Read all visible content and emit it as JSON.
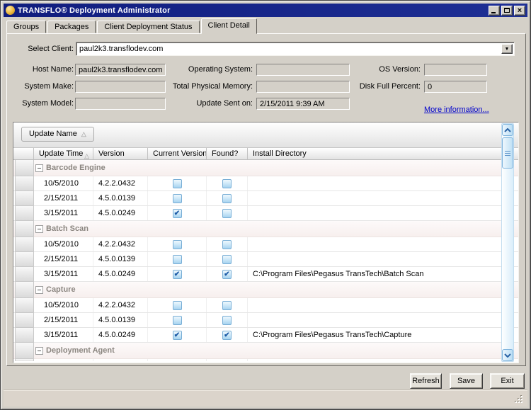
{
  "window": {
    "title": "TRANSFLO® Deployment Administrator",
    "icon": "transflo-gold-sphere-icon",
    "close_glyph": "×"
  },
  "tabs": {
    "items": [
      {
        "label": "Groups"
      },
      {
        "label": "Packages"
      },
      {
        "label": "Client Deployment Status"
      },
      {
        "label": "Client Detail"
      }
    ],
    "active_index": 3
  },
  "form": {
    "select_client": {
      "label": "Select Client:",
      "value": "paul2k3.transflodev.com"
    },
    "host_name": {
      "label": "Host Name:",
      "value": "paul2k3.transflodev.com"
    },
    "operating_system": {
      "label": "Operating System:",
      "value": ""
    },
    "os_version": {
      "label": "OS Version:",
      "value": ""
    },
    "system_make": {
      "label": "System Make:",
      "value": ""
    },
    "total_physical_memory": {
      "label": "Total Physical Memory:",
      "value": ""
    },
    "disk_full_percent": {
      "label": "Disk Full Percent:",
      "value": "0"
    },
    "system_model": {
      "label": "System Model:",
      "value": ""
    },
    "update_sent_on": {
      "label": "Update Sent on:",
      "value": "2/15/2011 9:39 AM"
    },
    "more_information_link": "More information..."
  },
  "grid": {
    "group_by": {
      "button_label": "Update Name",
      "sort_indicator": "△"
    },
    "check_glyph": "✔",
    "columns": [
      {
        "label": ""
      },
      {
        "label": "Update Time",
        "sort": "△"
      },
      {
        "label": "Version"
      },
      {
        "label": "Current Version?"
      },
      {
        "label": "Found?"
      },
      {
        "label": "Install Directory"
      }
    ],
    "groups": [
      {
        "name": "Barcode Engine",
        "rows": [
          {
            "update_time": "10/5/2010",
            "version": "4.2.2.0432",
            "current_version": false,
            "found": false,
            "install_directory": ""
          },
          {
            "update_time": "2/15/2011",
            "version": "4.5.0.0139",
            "current_version": false,
            "found": false,
            "install_directory": ""
          },
          {
            "update_time": "3/15/2011",
            "version": "4.5.0.0249",
            "current_version": true,
            "found": false,
            "install_directory": ""
          }
        ]
      },
      {
        "name": "Batch Scan",
        "rows": [
          {
            "update_time": "10/5/2010",
            "version": "4.2.2.0432",
            "current_version": false,
            "found": false,
            "install_directory": ""
          },
          {
            "update_time": "2/15/2011",
            "version": "4.5.0.0139",
            "current_version": false,
            "found": false,
            "install_directory": ""
          },
          {
            "update_time": "3/15/2011",
            "version": "4.5.0.0249",
            "current_version": true,
            "found": true,
            "install_directory": "C:\\Program Files\\Pegasus TransTech\\Batch Scan"
          }
        ]
      },
      {
        "name": "Capture",
        "rows": [
          {
            "update_time": "10/5/2010",
            "version": "4.2.2.0432",
            "current_version": false,
            "found": false,
            "install_directory": ""
          },
          {
            "update_time": "2/15/2011",
            "version": "4.5.0.0139",
            "current_version": false,
            "found": false,
            "install_directory": ""
          },
          {
            "update_time": "3/15/2011",
            "version": "4.5.0.0249",
            "current_version": true,
            "found": true,
            "install_directory": "C:\\Program Files\\Pegasus TransTech\\Capture"
          }
        ]
      },
      {
        "name": "Deployment Agent",
        "rows": [],
        "partially_visible": true
      }
    ]
  },
  "footer": {
    "refresh": "Refresh",
    "save": "Save",
    "exit": "Exit"
  },
  "colors": {
    "titlebar": "#101d7e",
    "dialog_bg": "#d4d0c8",
    "link": "#0000cc",
    "checkbox_border": "#78aed6",
    "check_mark": "#1c5ba6",
    "group_header_text": "#8b8680",
    "scrollbar_blue": "#7fb4dd"
  }
}
